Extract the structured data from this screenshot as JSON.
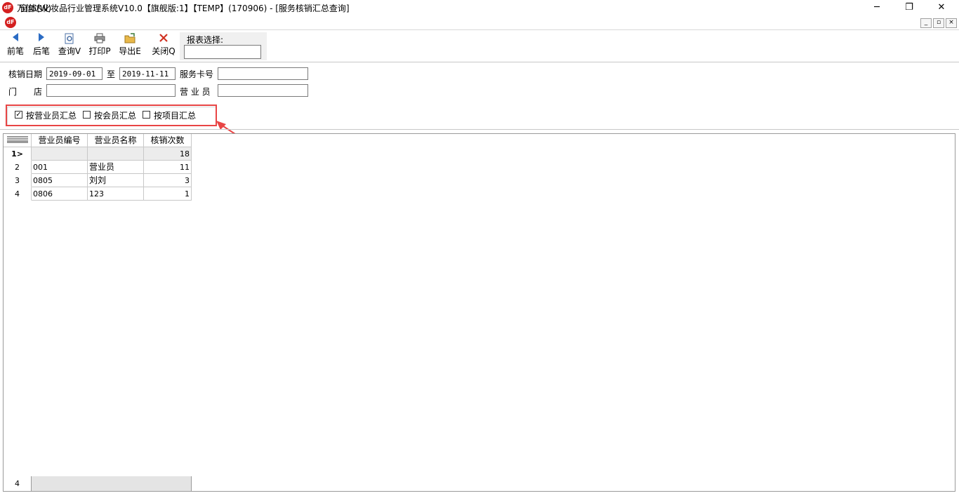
{
  "window": {
    "title": "万信达化妆品行业管理系统V10.0【旗舰版:1】【TEMP】(170906) - [服务核销汇总查询]",
    "logo_icon": "app-logo-icon",
    "controls": {
      "minimize": "─",
      "restore": "❐",
      "close": "✕"
    }
  },
  "menubar": {
    "window_menu": "窗体(W)",
    "mdi_controls": {
      "minimize": "_",
      "restore": "▫",
      "close": "×"
    }
  },
  "toolbar": {
    "buttons": [
      {
        "label": "前笔",
        "icon": "arrow-left-icon"
      },
      {
        "label": "后笔",
        "icon": "arrow-right-icon"
      },
      {
        "label": "查询V",
        "icon": "search-doc-icon"
      },
      {
        "label": "打印P",
        "icon": "printer-icon"
      },
      {
        "label": "导出E",
        "icon": "export-folder-icon"
      },
      {
        "label": "关闭Q",
        "icon": "close-x-icon"
      }
    ],
    "report_select_label": "报表选择:",
    "report_select_value": ""
  },
  "filters": {
    "date_label": "核销日期",
    "date_from": "2019-09-01",
    "to_label": "至",
    "date_to": "2019-11-11",
    "card_label": "服务卡号",
    "card_value": "",
    "store_label": "门　　店",
    "store_value": "",
    "clerk_label": "营 业 员",
    "clerk_value": ""
  },
  "summary_options": [
    {
      "label": "按营业员汇总",
      "checked": true
    },
    {
      "label": "按会员汇总",
      "checked": false
    },
    {
      "label": "按项目汇总",
      "checked": false
    }
  ],
  "grid": {
    "columns": [
      "营业员编号",
      "营业员名称",
      "核销次数"
    ],
    "rows": [
      {
        "indicator": "1>",
        "code": "",
        "name": "",
        "count": "18"
      },
      {
        "indicator": "2",
        "code": "001",
        "name": "营业员",
        "count": "11"
      },
      {
        "indicator": "3",
        "code": "0805",
        "name": "刘刘",
        "count": "3"
      },
      {
        "indicator": "4",
        "code": "0806",
        "name": "123",
        "count": "1"
      }
    ],
    "footer_count": "4"
  },
  "colors": {
    "accent": "#e84545",
    "logo": "#d42020",
    "arrow_blue": "#2b6cc4",
    "close_red": "#d03020"
  }
}
